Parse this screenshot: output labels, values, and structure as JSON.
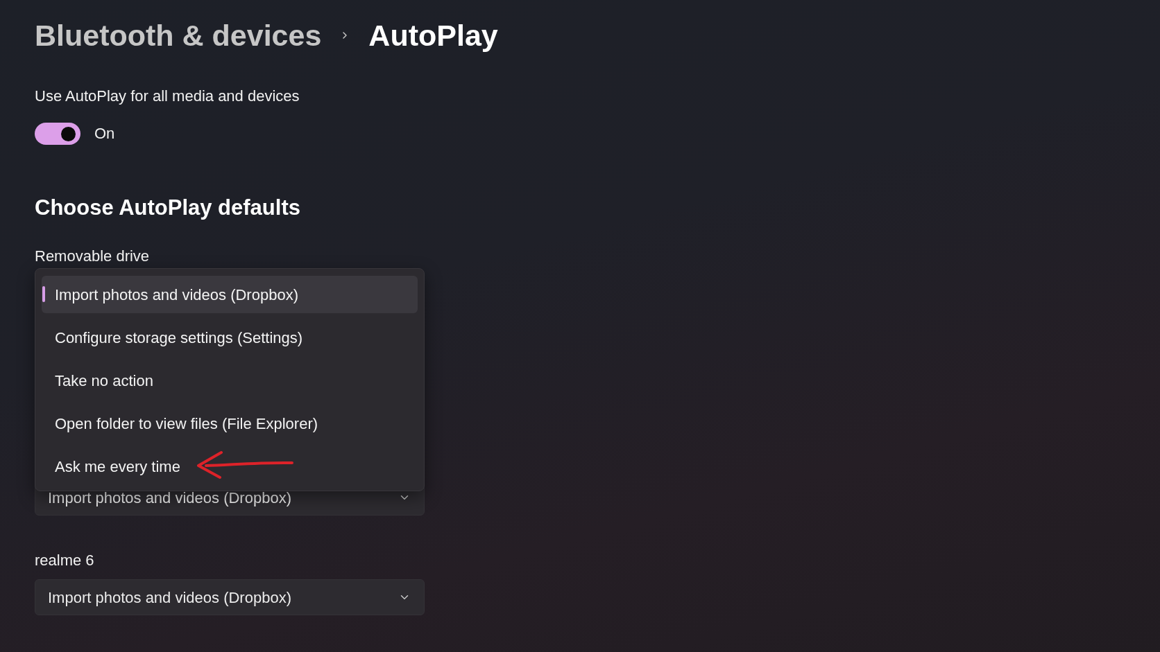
{
  "breadcrumb": [
    {
      "label": "Bluetooth & devices",
      "current": false
    },
    {
      "label": "AutoPlay",
      "current": true
    }
  ],
  "autoplay": {
    "label": "Use AutoPlay for all media and devices",
    "toggle": {
      "on": true,
      "label": "On"
    }
  },
  "section": {
    "title": "Choose AutoPlay defaults",
    "devices": [
      {
        "label": "Removable drive",
        "dropdown": {
          "expanded": true,
          "options": [
            {
              "label": "Import photos and videos (Dropbox)",
              "selected": true
            },
            {
              "label": "Configure storage settings (Settings)",
              "selected": false
            },
            {
              "label": "Take no action",
              "selected": false
            },
            {
              "label": "Open folder to view files (File Explorer)",
              "selected": false
            },
            {
              "label": "Ask me every time",
              "selected": false
            }
          ]
        }
      },
      {
        "dropdown": {
          "expanded": false,
          "value": "Import photos and videos (Dropbox)"
        }
      },
      {
        "label": "realme 6",
        "dropdown": {
          "expanded": false,
          "value": "Import photos and videos (Dropbox)"
        }
      }
    ]
  }
}
